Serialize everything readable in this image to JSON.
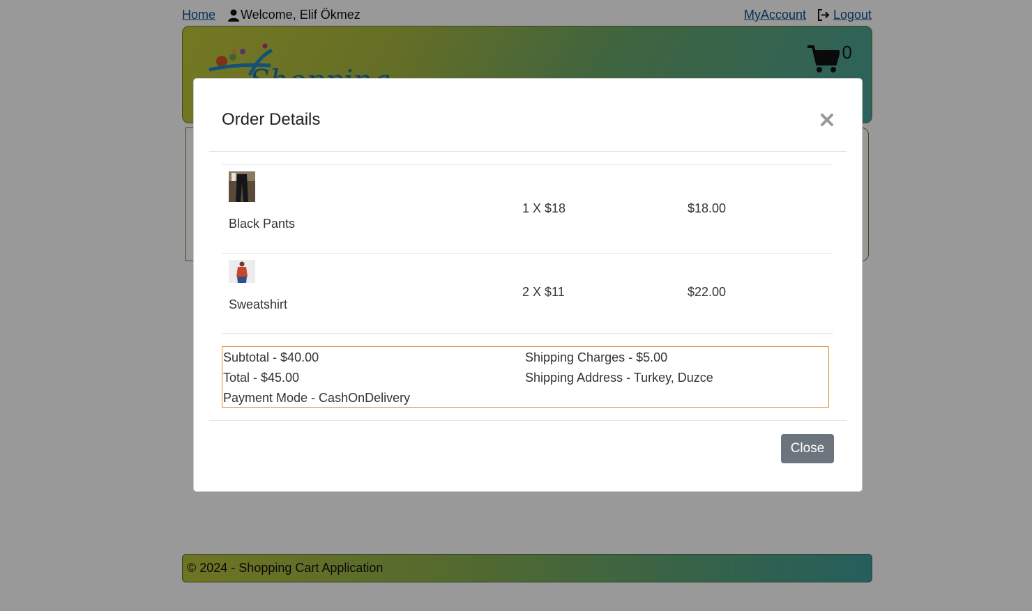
{
  "nav": {
    "home": "Home",
    "welcome": "Welcome, Elif Ökmez",
    "my_account": "MyAccount",
    "logout": "Logout"
  },
  "header": {
    "logo_text": "Shopping",
    "cart_count": "0"
  },
  "modal": {
    "title": "Order Details",
    "items": [
      {
        "name": "Black Pants",
        "quantity_price": "1 X $18",
        "amount": "$18.00",
        "thumb_icon": "pants-thumbnail"
      },
      {
        "name": "Sweatshirt",
        "quantity_price": "2 X $11",
        "amount": "$22.00",
        "thumb_icon": "sweatshirt-thumbnail"
      }
    ],
    "summary": {
      "subtotal": "Subtotal - $40.00",
      "shipping_charges": "Shipping Charges - $5.00",
      "total": "Total - $45.00",
      "shipping_address": "Shipping Address - Turkey, Duzce",
      "payment_mode": "Payment Mode - CashOnDelivery"
    },
    "close_label": "Close"
  },
  "footer": {
    "text": "© 2024 - Shopping Cart Application"
  },
  "colors": {
    "accent_link": "#0d4f8b",
    "summary_border": "#e08a3c",
    "close_button": "#6c757d"
  }
}
